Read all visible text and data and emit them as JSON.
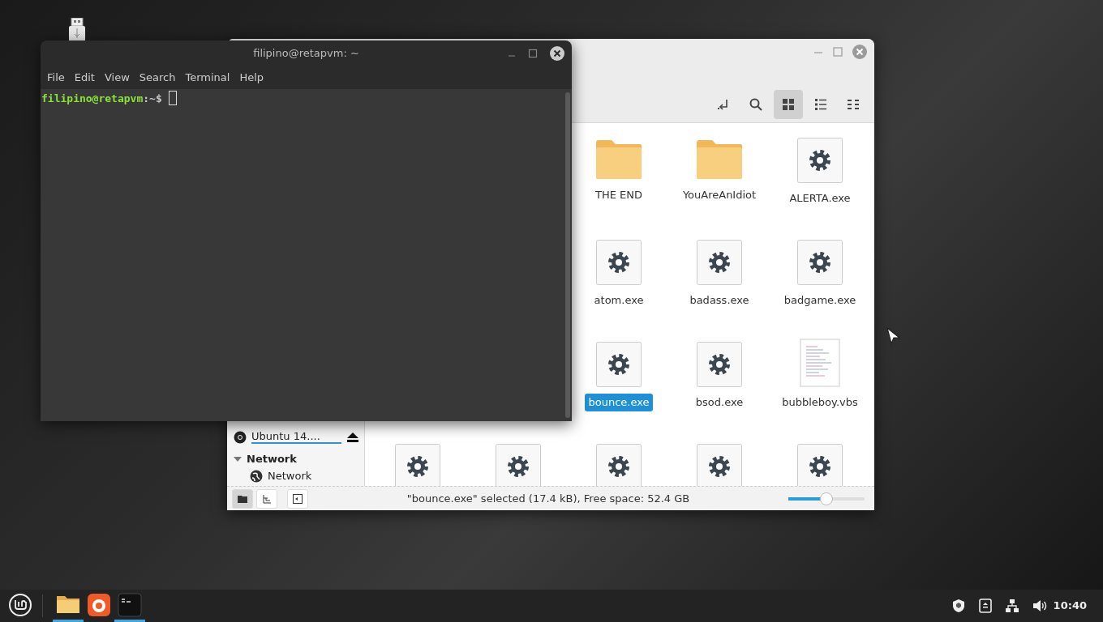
{
  "terminal": {
    "title": "filipino@retapvm: ~",
    "menu": [
      "File",
      "Edit",
      "View",
      "Search",
      "Terminal",
      "Help"
    ],
    "prompt_user": "filipino@retapvm",
    "prompt_path": ":~$"
  },
  "file_manager": {
    "view_buttons": [
      {
        "kind": "icons",
        "selected": true
      },
      {
        "kind": "list",
        "selected": false
      },
      {
        "kind": "compact",
        "selected": false
      }
    ],
    "sidebar": {
      "device": "Ubuntu 14....",
      "section": "Network",
      "expanded": true,
      "network_item": "Network"
    },
    "rows": [
      [
        {
          "name": "THE END",
          "kind": "folder",
          "selected": false
        },
        {
          "name": "YouAreAnIdiot",
          "kind": "folder",
          "selected": false
        },
        {
          "name": "ALERTA.exe",
          "kind": "exe",
          "selected": false
        }
      ],
      [
        {
          "name": "atom.exe",
          "kind": "exe",
          "selected": false
        },
        {
          "name": "badass.exe",
          "kind": "exe",
          "selected": false
        },
        {
          "name": "badgame.exe",
          "kind": "exe",
          "selected": false
        }
      ],
      [
        {
          "name": "bounce.exe",
          "kind": "exe",
          "selected": true
        },
        {
          "name": "bsod.exe",
          "kind": "exe",
          "selected": false
        },
        {
          "name": "bubbleboy.vbs",
          "kind": "script",
          "selected": false
        }
      ],
      [
        {
          "kind": "exe"
        },
        {
          "kind": "exe"
        },
        {
          "kind": "exe"
        },
        {
          "kind": "exe"
        },
        {
          "kind": "exe"
        }
      ]
    ],
    "status_text": "\"bounce.exe\" selected (17.4 kB), Free space: 52.4 GB",
    "zoom": {
      "level": 0.5
    }
  },
  "taskbar": {
    "apps": [
      {
        "kind": "files",
        "running": true
      },
      {
        "kind": "browser",
        "running": false
      },
      {
        "kind": "terminal",
        "running": true
      }
    ],
    "clock": "10:40"
  }
}
